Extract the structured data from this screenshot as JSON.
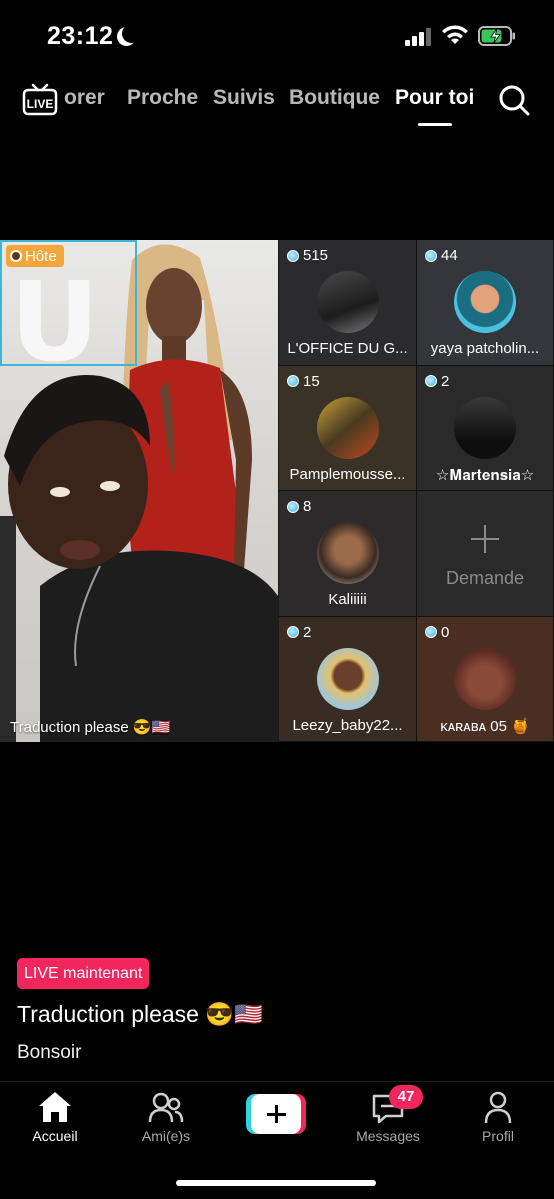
{
  "status_bar": {
    "time": "23:12",
    "battery_state": "charging",
    "icons": [
      "moon-icon",
      "signal-icon",
      "wifi-icon",
      "battery-icon"
    ]
  },
  "top_nav": {
    "tabs": [
      {
        "label": "orer",
        "active": false
      },
      {
        "label": "Proche",
        "active": false
      },
      {
        "label": "Suivis",
        "active": false
      },
      {
        "label": "Boutique",
        "active": false
      },
      {
        "label": "Pour toi",
        "active": true
      }
    ],
    "icons": [
      "live-tv-icon",
      "search-icon"
    ]
  },
  "live": {
    "host_badge": "Hôte",
    "host_caption": "Traduction please 😎🇺🇸",
    "guests": [
      {
        "count": "515",
        "name": "L'OFFICE DU G..."
      },
      {
        "count": "44",
        "name": "yaya patcholin..."
      },
      {
        "count": "15",
        "name": "Pamplemousse..."
      },
      {
        "count": "2",
        "name": "☆𝐌𝐚𝐫𝐭𝐞𝐧𝐬𝐢𝐚☆"
      },
      {
        "count": "8",
        "name": "Kaliiiii"
      },
      {
        "request_label": "Demande"
      },
      {
        "count": "2",
        "name": "Leezy_baby22..."
      },
      {
        "count": "0",
        "name": "ᴋᴀʀᴀʙᴀ 05 🍯"
      }
    ]
  },
  "info": {
    "live_pill": "LIVE maintenant",
    "title": "Traduction please 😎🇺🇸",
    "subtitle": "Bonsoir"
  },
  "tab_bar": {
    "items": [
      {
        "label": "Accueil",
        "icon": "home-icon",
        "active": true
      },
      {
        "label": "Ami(e)s",
        "icon": "friends-icon",
        "active": false
      },
      {
        "label": "",
        "icon": "create-plus-icon",
        "active": false
      },
      {
        "label": "Messages",
        "icon": "messages-icon",
        "active": false
      },
      {
        "label": "Profil",
        "icon": "profile-icon",
        "active": false
      }
    ],
    "messages_badge": "47"
  },
  "colors": {
    "accent_pink": "#f0265d",
    "accent_cyan": "#2fd3e0",
    "host_badge": "#f4a63a",
    "host_border": "#3fb5d6"
  }
}
